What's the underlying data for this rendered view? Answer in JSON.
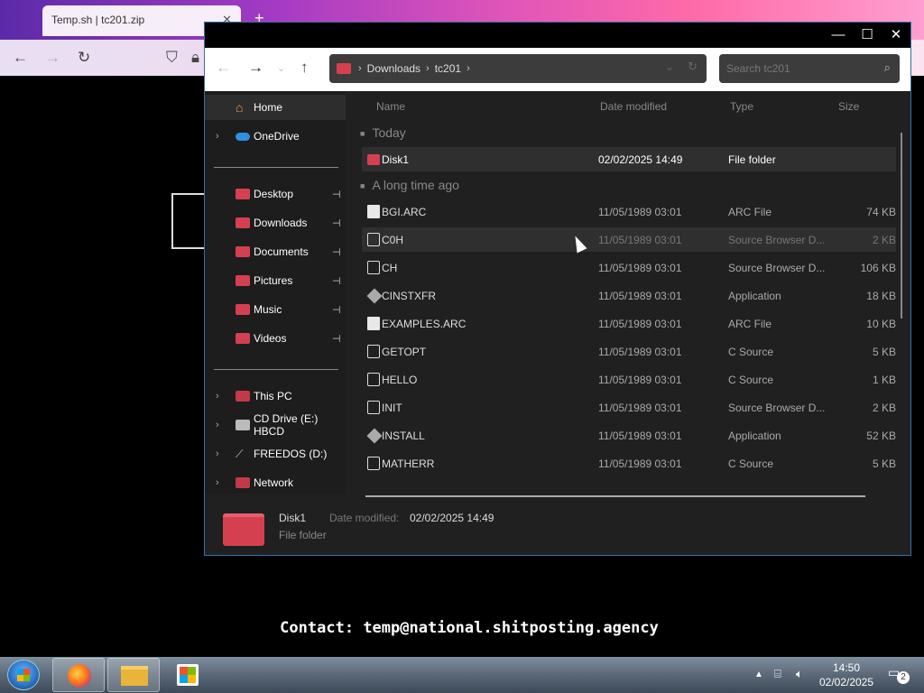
{
  "browser": {
    "tab_title": "Temp.sh | tc201.zip",
    "tab_close": "✕",
    "new_tab": "+"
  },
  "page": {
    "contact_label": "Contact:",
    "contact_email": "temp@national.shitposting.agency"
  },
  "explorer": {
    "window_controls": [
      "—",
      "☐",
      "✕"
    ],
    "breadcrumb": [
      "Downloads",
      "tc201"
    ],
    "search_placeholder": "Search tc201",
    "sidebar": {
      "home": "Home",
      "onedrive": "OneDrive",
      "pinned": [
        "Desktop",
        "Downloads",
        "Documents",
        "Pictures",
        "Music",
        "Videos"
      ],
      "drives": [
        "This PC",
        "CD Drive (E:) HBCD",
        "FREEDOS (D:)",
        "Network"
      ]
    },
    "columns": [
      "Name",
      "Date modified",
      "Type",
      "Size"
    ],
    "groups": [
      "Today",
      "A long time ago"
    ],
    "today_rows": [
      {
        "name": "Disk1",
        "date": "02/02/2025 14:49",
        "type": "File folder",
        "size": "",
        "icon": "folder-icon"
      }
    ],
    "old_rows": [
      {
        "name": "BGI.ARC",
        "date": "11/05/1989 03:01",
        "type": "ARC File",
        "size": "74 KB",
        "icon": "document-icon"
      },
      {
        "name": "C0H",
        "date": "11/05/1989 03:01",
        "type": "Source Browser D...",
        "size": "2 KB",
        "icon": "source-file-icon"
      },
      {
        "name": "CH",
        "date": "11/05/1989 03:01",
        "type": "Source Browser D...",
        "size": "106 KB",
        "icon": "source-file-icon"
      },
      {
        "name": "CINSTXFR",
        "date": "11/05/1989 03:01",
        "type": "Application",
        "size": "18 KB",
        "icon": "application-icon"
      },
      {
        "name": "EXAMPLES.ARC",
        "date": "11/05/1989 03:01",
        "type": "ARC File",
        "size": "10 KB",
        "icon": "document-icon"
      },
      {
        "name": "GETOPT",
        "date": "11/05/1989 03:01",
        "type": "C Source",
        "size": "5 KB",
        "icon": "source-file-icon"
      },
      {
        "name": "HELLO",
        "date": "11/05/1989 03:01",
        "type": "C Source",
        "size": "1 KB",
        "icon": "source-file-icon"
      },
      {
        "name": "INIT",
        "date": "11/05/1989 03:01",
        "type": "Source Browser D...",
        "size": "2 KB",
        "icon": "source-file-icon"
      },
      {
        "name": "INSTALL",
        "date": "11/05/1989 03:01",
        "type": "Application",
        "size": "52 KB",
        "icon": "application-icon"
      },
      {
        "name": "MATHERR",
        "date": "11/05/1989 03:01",
        "type": "C Source",
        "size": "5 KB",
        "icon": "source-file-icon"
      }
    ],
    "details": {
      "name": "Disk1",
      "type": "File folder",
      "date_label": "Date modified:",
      "date_value": "02/02/2025 14:49"
    }
  },
  "taskbar": {
    "time": "14:50",
    "date": "02/02/2025",
    "notification_count": "2"
  },
  "colors": {
    "folder": "#d54050",
    "explorer_bg": "#202020",
    "accent_border": "#3a6ea5"
  }
}
